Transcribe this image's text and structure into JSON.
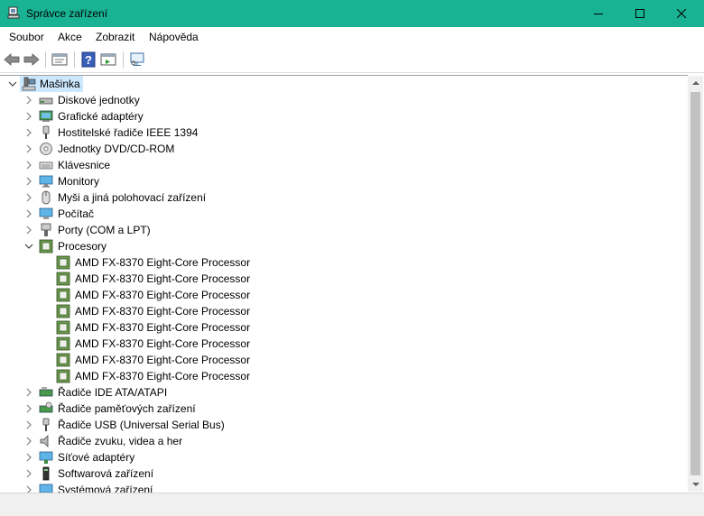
{
  "window": {
    "title": "Správce zařízení"
  },
  "menu": [
    "Soubor",
    "Akce",
    "Zobrazit",
    "Nápověda"
  ],
  "toolbar": {
    "buttons": [
      "back-icon",
      "forward-icon",
      "properties-icon",
      "help-icon",
      "show-hidden-icon",
      "monitor-scan-icon"
    ]
  },
  "tree": {
    "root": "Mašinka",
    "categories": [
      {
        "label": "Diskové jednotky",
        "icon": "disk-drive-icon"
      },
      {
        "label": "Grafické adaptéry",
        "icon": "display-adapter-icon"
      },
      {
        "label": "Hostitelské řadiče IEEE 1394",
        "icon": "ieee1394-icon"
      },
      {
        "label": "Jednotky DVD/CD-ROM",
        "icon": "dvd-drive-icon"
      },
      {
        "label": "Klávesnice",
        "icon": "keyboard-icon"
      },
      {
        "label": "Monitory",
        "icon": "monitor-icon"
      },
      {
        "label": "Myši a jiná polohovací zařízení",
        "icon": "mouse-icon"
      },
      {
        "label": "Počítač",
        "icon": "computer-icon"
      },
      {
        "label": "Porty (COM a LPT)",
        "icon": "port-icon"
      },
      {
        "label": "Procesory",
        "icon": "processor-icon"
      }
    ],
    "processors": [
      "AMD FX-8370 Eight-Core Processor",
      "AMD FX-8370 Eight-Core Processor",
      "AMD FX-8370 Eight-Core Processor",
      "AMD FX-8370 Eight-Core Processor",
      "AMD FX-8370 Eight-Core Processor",
      "AMD FX-8370 Eight-Core Processor",
      "AMD FX-8370 Eight-Core Processor",
      "AMD FX-8370 Eight-Core Processor"
    ],
    "categories_after": [
      {
        "label": "Řadiče IDE ATA/ATAPI",
        "icon": "ide-controller-icon"
      },
      {
        "label": "Řadiče paměťových zařízení",
        "icon": "storage-controller-icon"
      },
      {
        "label": "Řadiče USB (Universal Serial Bus)",
        "icon": "usb-icon"
      },
      {
        "label": "Řadiče zvuku, videa a her",
        "icon": "sound-icon"
      },
      {
        "label": "Síťové adaptéry",
        "icon": "network-adapter-icon"
      },
      {
        "label": "Softwarová zařízení",
        "icon": "software-device-icon"
      },
      {
        "label": "Systémová zařízení",
        "icon": "system-device-icon"
      }
    ]
  },
  "colors": {
    "titlebar": "#19b394",
    "selection": "#cce8ff",
    "cpu_green": "#4a7a32"
  }
}
